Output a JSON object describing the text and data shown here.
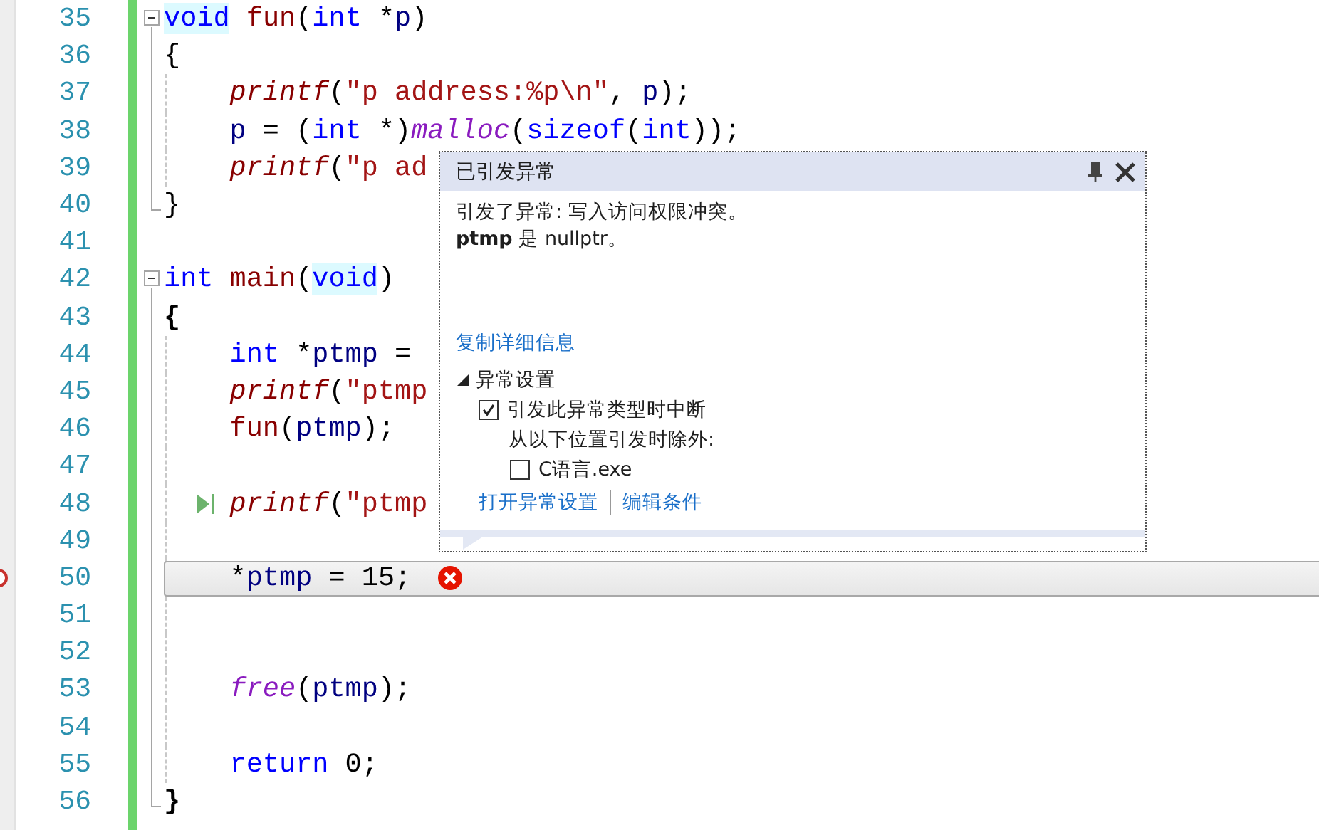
{
  "editor": {
    "lines": [
      {
        "number": "35",
        "collapsible": true,
        "code": [
          {
            "kind": "kw",
            "text": "void",
            "hl": true
          },
          {
            "kind": "fn",
            "text": " fun"
          },
          {
            "kind": "op",
            "text": "("
          },
          {
            "kind": "kw",
            "text": "int"
          },
          {
            "kind": "op",
            "text": " *"
          },
          {
            "kind": "id",
            "text": "p"
          },
          {
            "kind": "op",
            "text": ")"
          }
        ]
      },
      {
        "number": "36",
        "code": [
          {
            "kind": "op",
            "text": "{"
          }
        ]
      },
      {
        "number": "37",
        "indented": true,
        "code": [
          {
            "kind": "lib",
            "text": "printf"
          },
          {
            "kind": "op",
            "text": "("
          },
          {
            "kind": "str",
            "text": "\"p address:%p\\n\""
          },
          {
            "kind": "op",
            "text": ", "
          },
          {
            "kind": "id",
            "text": "p"
          },
          {
            "kind": "op",
            "text": ");"
          }
        ]
      },
      {
        "number": "38",
        "indented": true,
        "code": [
          {
            "kind": "id",
            "text": "p"
          },
          {
            "kind": "op",
            "text": " = ("
          },
          {
            "kind": "kw",
            "text": "int"
          },
          {
            "kind": "op",
            "text": " *)"
          },
          {
            "kind": "mac",
            "text": "malloc"
          },
          {
            "kind": "op",
            "text": "("
          },
          {
            "kind": "kw",
            "text": "sizeof"
          },
          {
            "kind": "op",
            "text": "("
          },
          {
            "kind": "kw",
            "text": "int"
          },
          {
            "kind": "op",
            "text": "));"
          }
        ]
      },
      {
        "number": "39",
        "indented": true,
        "code": [
          {
            "kind": "lib",
            "text": "printf"
          },
          {
            "kind": "op",
            "text": "("
          },
          {
            "kind": "str",
            "text": "\"p ad"
          }
        ]
      },
      {
        "number": "40",
        "block_end": true,
        "code": [
          {
            "kind": "op",
            "text": "}"
          }
        ]
      },
      {
        "number": "41"
      },
      {
        "number": "42",
        "collapsible": true,
        "code": [
          {
            "kind": "kw",
            "text": "int"
          },
          {
            "kind": "fn",
            "text": " main"
          },
          {
            "kind": "op",
            "text": "("
          },
          {
            "kind": "kw",
            "text": "void",
            "hl": true
          },
          {
            "kind": "op",
            "text": ")"
          }
        ]
      },
      {
        "number": "43",
        "code": [
          {
            "kind": "bold",
            "text": "{"
          }
        ]
      },
      {
        "number": "44",
        "indented": true,
        "code": [
          {
            "kind": "kw",
            "text": "int"
          },
          {
            "kind": "op",
            "text": " *"
          },
          {
            "kind": "id",
            "text": "ptmp"
          },
          {
            "kind": "op",
            "text": " ="
          }
        ]
      },
      {
        "number": "45",
        "indented": true,
        "code": [
          {
            "kind": "lib",
            "text": "printf"
          },
          {
            "kind": "op",
            "text": "("
          },
          {
            "kind": "str",
            "text": "\"ptmp"
          }
        ]
      },
      {
        "number": "46",
        "indented": true,
        "code": [
          {
            "kind": "fn",
            "text": "fun"
          },
          {
            "kind": "op",
            "text": "("
          },
          {
            "kind": "id",
            "text": "ptmp"
          },
          {
            "kind": "op",
            "text": ");"
          }
        ]
      },
      {
        "number": "47"
      },
      {
        "number": "48",
        "indented": true,
        "next_statement": true,
        "code": [
          {
            "kind": "lib",
            "text": "printf"
          },
          {
            "kind": "op",
            "text": "("
          },
          {
            "kind": "str",
            "text": "\"ptmp"
          }
        ]
      },
      {
        "number": "49"
      },
      {
        "number": "50",
        "indented": true,
        "current": true,
        "breakpoint": true,
        "error": true,
        "code": [
          {
            "kind": "op",
            "text": "*"
          },
          {
            "kind": "id",
            "text": "ptmp"
          },
          {
            "kind": "op",
            "text": " = "
          },
          {
            "kind": "num",
            "text": "15"
          },
          {
            "kind": "op",
            "text": ";"
          }
        ]
      },
      {
        "number": "51"
      },
      {
        "number": "52"
      },
      {
        "number": "53",
        "indented": true,
        "code": [
          {
            "kind": "mac",
            "text": "free"
          },
          {
            "kind": "op",
            "text": "("
          },
          {
            "kind": "id",
            "text": "ptmp"
          },
          {
            "kind": "op",
            "text": ");"
          }
        ]
      },
      {
        "number": "54"
      },
      {
        "number": "55",
        "indented": true,
        "code": [
          {
            "kind": "kw",
            "text": "return"
          },
          {
            "kind": "num",
            "text": " 0"
          },
          {
            "kind": "op",
            "text": ";"
          }
        ]
      },
      {
        "number": "56",
        "block_end": true,
        "code": [
          {
            "kind": "bold",
            "text": "}"
          }
        ]
      }
    ]
  },
  "exception_popup": {
    "title": "已引发异常",
    "message": [
      "引发了异常: 写入访问权限冲突。",
      "**ptmp** 是 nullptr。"
    ],
    "copy_link": "复制详细信息",
    "settings": {
      "label": "异常设置",
      "expanded": true,
      "break_option": {
        "label": "引发此异常类型时中断",
        "checked": true
      },
      "except_label": "从以下位置引发时除外:",
      "modules": [
        {
          "label": "C语言.exe",
          "checked": false
        }
      ]
    },
    "links": [
      "打开异常设置",
      "编辑条件"
    ]
  }
}
